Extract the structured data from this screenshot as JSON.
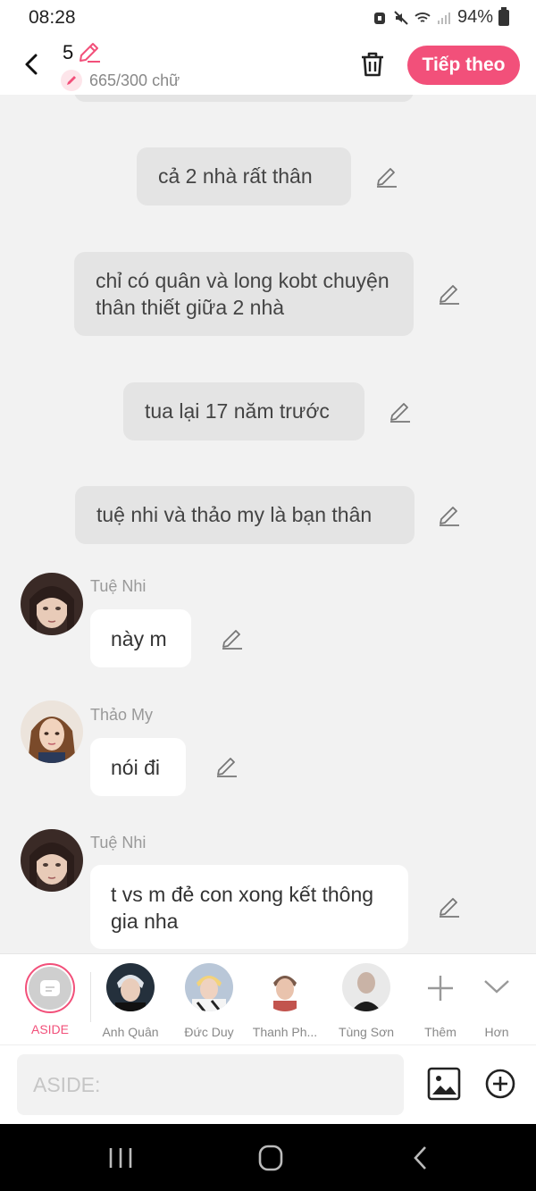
{
  "status_bar": {
    "time": "08:28",
    "battery": "94%"
  },
  "header": {
    "scene_number": "5",
    "word_count": "665/300 chữ",
    "next_label": "Tiếp theo"
  },
  "messages": [
    {
      "type": "narration",
      "text": "cả 2 nhà rất thân"
    },
    {
      "type": "narration",
      "text": "chỉ có quân và long kobt chuyện thân thiết giữa 2 nhà"
    },
    {
      "type": "narration",
      "text": "tua lại 17 năm trước"
    },
    {
      "type": "narration",
      "text": "tuệ nhi và thảo my là bạn thân"
    },
    {
      "type": "character",
      "name": "Tuệ Nhi",
      "text": "này m"
    },
    {
      "type": "character",
      "name": "Thảo My",
      "text": "nói đi"
    },
    {
      "type": "character",
      "name": "Tuệ Nhi",
      "text": "t vs m đẻ con xong kết thông gia nha"
    }
  ],
  "character_bar": {
    "aside_label": "ASIDE",
    "characters": [
      "Anh Quân",
      "Đức Duy",
      "Thanh Ph...",
      "Tùng Sơn"
    ],
    "more_label": "Thêm",
    "expand_label": "Hơn"
  },
  "input": {
    "placeholder": "ASIDE:"
  },
  "colors": {
    "accent": "#f2507a",
    "narration_bg": "#e4e4e4",
    "chat_bg": "#f2f2f2"
  }
}
